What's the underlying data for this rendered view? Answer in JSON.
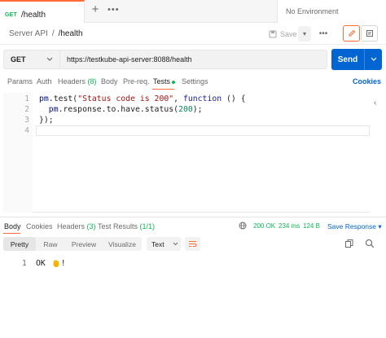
{
  "tabs": {
    "active": {
      "method": "GET",
      "title": "/health"
    },
    "environment": "No Environment"
  },
  "breadcrumb": {
    "collection": "Server API",
    "separator": "/",
    "request": "/health"
  },
  "toolbar": {
    "save_label": "Save"
  },
  "request": {
    "method": "GET",
    "url": "https://testkube-api-server:8088/health",
    "send_label": "Send"
  },
  "request_tabs": {
    "params": "Params",
    "auth": "Auth",
    "headers": "Headers",
    "headers_count": "(8)",
    "body": "Body",
    "prereq": "Pre-req.",
    "tests": "Tests",
    "settings": "Settings",
    "cookies": "Cookies"
  },
  "editor": {
    "line_numbers": [
      "1",
      "2",
      "3",
      "4"
    ],
    "lines": [
      [
        {
          "t": "pm",
          "c": "fn"
        },
        {
          "t": ".test(",
          "c": ""
        },
        {
          "t": "\"Status code is 200\"",
          "c": "str"
        },
        {
          "t": ", ",
          "c": ""
        },
        {
          "t": "function",
          "c": "kw"
        },
        {
          "t": " () {",
          "c": ""
        }
      ],
      [
        {
          "t": "  pm",
          "c": "fn"
        },
        {
          "t": ".response.to.have.status(",
          "c": ""
        },
        {
          "t": "200",
          "c": "num"
        },
        {
          "t": ");",
          "c": ""
        }
      ],
      [
        {
          "t": "});",
          "c": ""
        }
      ],
      [
        {
          "t": "",
          "c": ""
        }
      ]
    ]
  },
  "response_tabs": {
    "body": "Body",
    "cookies": "Cookies",
    "headers": "Headers",
    "headers_count": "(3)",
    "test_results": "Test Results",
    "test_results_count": "(1/1)"
  },
  "response_status": {
    "code": "200 OK",
    "time": "234 ms",
    "size": "124 B",
    "save_label": "Save Response"
  },
  "format_tabs": {
    "pretty": "Pretty",
    "raw": "Raw",
    "preview": "Preview",
    "visualize": "Visualize",
    "text_select": "Text"
  },
  "response_body": {
    "line_number": "1",
    "text_before": "OK ",
    "text_after": "!"
  },
  "colors": {
    "accent": "#ff6c37",
    "primary": "#0265d2",
    "success": "#0cbb52"
  }
}
